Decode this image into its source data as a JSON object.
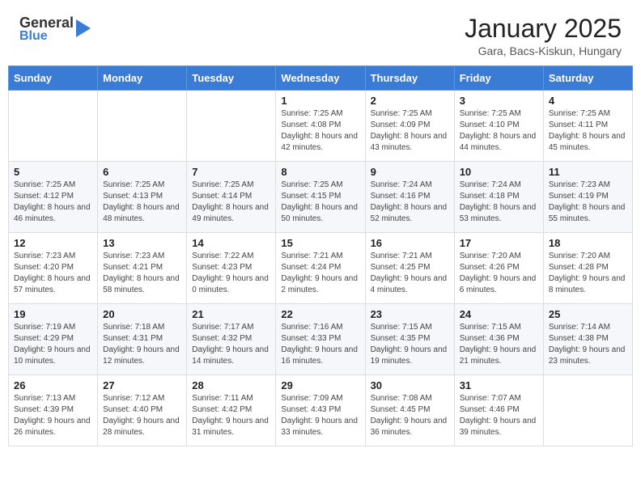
{
  "header": {
    "logo_line1": "General",
    "logo_line2": "Blue",
    "month_year": "January 2025",
    "location": "Gara, Bacs-Kiskun, Hungary"
  },
  "days_of_week": [
    "Sunday",
    "Monday",
    "Tuesday",
    "Wednesday",
    "Thursday",
    "Friday",
    "Saturday"
  ],
  "weeks": [
    [
      {
        "day": "",
        "info": ""
      },
      {
        "day": "",
        "info": ""
      },
      {
        "day": "",
        "info": ""
      },
      {
        "day": "1",
        "info": "Sunrise: 7:25 AM\nSunset: 4:08 PM\nDaylight: 8 hours and 42 minutes."
      },
      {
        "day": "2",
        "info": "Sunrise: 7:25 AM\nSunset: 4:09 PM\nDaylight: 8 hours and 43 minutes."
      },
      {
        "day": "3",
        "info": "Sunrise: 7:25 AM\nSunset: 4:10 PM\nDaylight: 8 hours and 44 minutes."
      },
      {
        "day": "4",
        "info": "Sunrise: 7:25 AM\nSunset: 4:11 PM\nDaylight: 8 hours and 45 minutes."
      }
    ],
    [
      {
        "day": "5",
        "info": "Sunrise: 7:25 AM\nSunset: 4:12 PM\nDaylight: 8 hours and 46 minutes."
      },
      {
        "day": "6",
        "info": "Sunrise: 7:25 AM\nSunset: 4:13 PM\nDaylight: 8 hours and 48 minutes."
      },
      {
        "day": "7",
        "info": "Sunrise: 7:25 AM\nSunset: 4:14 PM\nDaylight: 8 hours and 49 minutes."
      },
      {
        "day": "8",
        "info": "Sunrise: 7:25 AM\nSunset: 4:15 PM\nDaylight: 8 hours and 50 minutes."
      },
      {
        "day": "9",
        "info": "Sunrise: 7:24 AM\nSunset: 4:16 PM\nDaylight: 8 hours and 52 minutes."
      },
      {
        "day": "10",
        "info": "Sunrise: 7:24 AM\nSunset: 4:18 PM\nDaylight: 8 hours and 53 minutes."
      },
      {
        "day": "11",
        "info": "Sunrise: 7:23 AM\nSunset: 4:19 PM\nDaylight: 8 hours and 55 minutes."
      }
    ],
    [
      {
        "day": "12",
        "info": "Sunrise: 7:23 AM\nSunset: 4:20 PM\nDaylight: 8 hours and 57 minutes."
      },
      {
        "day": "13",
        "info": "Sunrise: 7:23 AM\nSunset: 4:21 PM\nDaylight: 8 hours and 58 minutes."
      },
      {
        "day": "14",
        "info": "Sunrise: 7:22 AM\nSunset: 4:23 PM\nDaylight: 9 hours and 0 minutes."
      },
      {
        "day": "15",
        "info": "Sunrise: 7:21 AM\nSunset: 4:24 PM\nDaylight: 9 hours and 2 minutes."
      },
      {
        "day": "16",
        "info": "Sunrise: 7:21 AM\nSunset: 4:25 PM\nDaylight: 9 hours and 4 minutes."
      },
      {
        "day": "17",
        "info": "Sunrise: 7:20 AM\nSunset: 4:26 PM\nDaylight: 9 hours and 6 minutes."
      },
      {
        "day": "18",
        "info": "Sunrise: 7:20 AM\nSunset: 4:28 PM\nDaylight: 9 hours and 8 minutes."
      }
    ],
    [
      {
        "day": "19",
        "info": "Sunrise: 7:19 AM\nSunset: 4:29 PM\nDaylight: 9 hours and 10 minutes."
      },
      {
        "day": "20",
        "info": "Sunrise: 7:18 AM\nSunset: 4:31 PM\nDaylight: 9 hours and 12 minutes."
      },
      {
        "day": "21",
        "info": "Sunrise: 7:17 AM\nSunset: 4:32 PM\nDaylight: 9 hours and 14 minutes."
      },
      {
        "day": "22",
        "info": "Sunrise: 7:16 AM\nSunset: 4:33 PM\nDaylight: 9 hours and 16 minutes."
      },
      {
        "day": "23",
        "info": "Sunrise: 7:15 AM\nSunset: 4:35 PM\nDaylight: 9 hours and 19 minutes."
      },
      {
        "day": "24",
        "info": "Sunrise: 7:15 AM\nSunset: 4:36 PM\nDaylight: 9 hours and 21 minutes."
      },
      {
        "day": "25",
        "info": "Sunrise: 7:14 AM\nSunset: 4:38 PM\nDaylight: 9 hours and 23 minutes."
      }
    ],
    [
      {
        "day": "26",
        "info": "Sunrise: 7:13 AM\nSunset: 4:39 PM\nDaylight: 9 hours and 26 minutes."
      },
      {
        "day": "27",
        "info": "Sunrise: 7:12 AM\nSunset: 4:40 PM\nDaylight: 9 hours and 28 minutes."
      },
      {
        "day": "28",
        "info": "Sunrise: 7:11 AM\nSunset: 4:42 PM\nDaylight: 9 hours and 31 minutes."
      },
      {
        "day": "29",
        "info": "Sunrise: 7:09 AM\nSunset: 4:43 PM\nDaylight: 9 hours and 33 minutes."
      },
      {
        "day": "30",
        "info": "Sunrise: 7:08 AM\nSunset: 4:45 PM\nDaylight: 9 hours and 36 minutes."
      },
      {
        "day": "31",
        "info": "Sunrise: 7:07 AM\nSunset: 4:46 PM\nDaylight: 9 hours and 39 minutes."
      },
      {
        "day": "",
        "info": ""
      }
    ]
  ]
}
